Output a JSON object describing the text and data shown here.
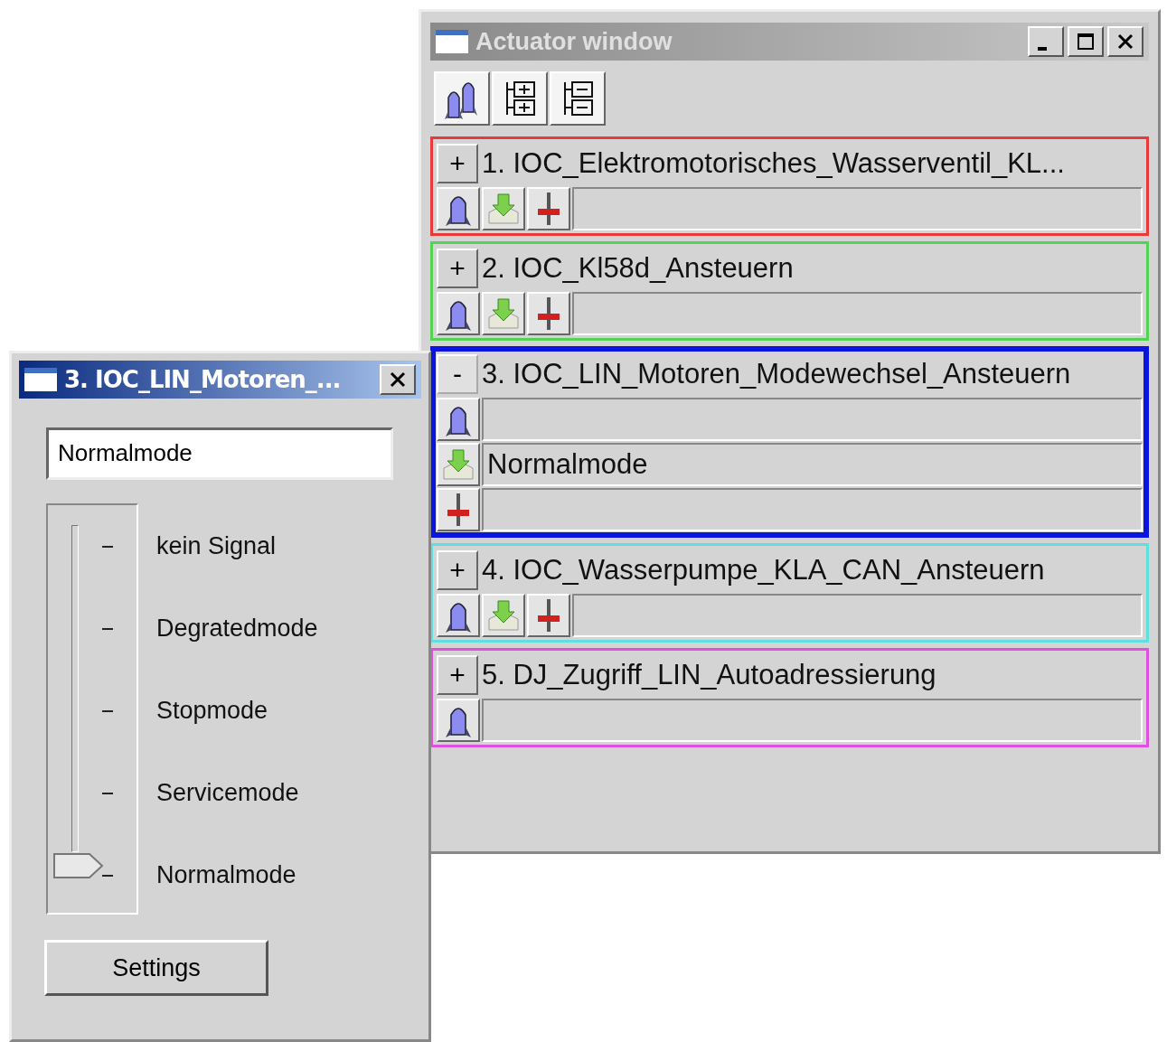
{
  "actuator_window": {
    "title": "Actuator window",
    "active": false,
    "actuators": [
      {
        "toggle": "+",
        "label": "1. IOC_Elektromotorisches_Wasserventil_KL...",
        "color": "#e83a3a",
        "expanded": false,
        "selected": false,
        "controls": [
          {
            "kind": "run"
          },
          {
            "kind": "download"
          },
          {
            "kind": "slider"
          }
        ]
      },
      {
        "toggle": "+",
        "label": "2. IOC_Kl58d_Ansteuern",
        "color": "#52d452",
        "expanded": false,
        "selected": false,
        "controls": [
          {
            "kind": "run"
          },
          {
            "kind": "download"
          },
          {
            "kind": "slider"
          }
        ]
      },
      {
        "toggle": "-",
        "label": "3. IOC_LIN_Motoren_Modewechsel_Ansteuern",
        "color": "#0a14e0",
        "expanded": true,
        "selected": true,
        "controls": [
          {
            "kind": "run"
          },
          {
            "kind": "download",
            "value": "Normalmode"
          },
          {
            "kind": "slider"
          }
        ]
      },
      {
        "toggle": "+",
        "label": "4. IOC_Wasserpumpe_KLA_CAN_Ansteuern",
        "color": "#5ee0e0",
        "expanded": false,
        "selected": false,
        "controls": [
          {
            "kind": "run"
          },
          {
            "kind": "download"
          },
          {
            "kind": "slider"
          }
        ]
      },
      {
        "toggle": "+",
        "label": "5. DJ_Zugriff_LIN_Autoadressierung",
        "color": "#e050e0",
        "expanded": false,
        "selected": false,
        "controls": [
          {
            "kind": "run"
          }
        ]
      }
    ]
  },
  "dialog": {
    "title": "3. IOC_LIN_Motoren_...",
    "active": true,
    "value": "Normalmode",
    "slider": {
      "level": 0,
      "labels": [
        "kein Signal",
        "Degratedmode",
        "Stopmode",
        "Servicemode",
        "Normalmode"
      ]
    },
    "button": "Settings"
  }
}
